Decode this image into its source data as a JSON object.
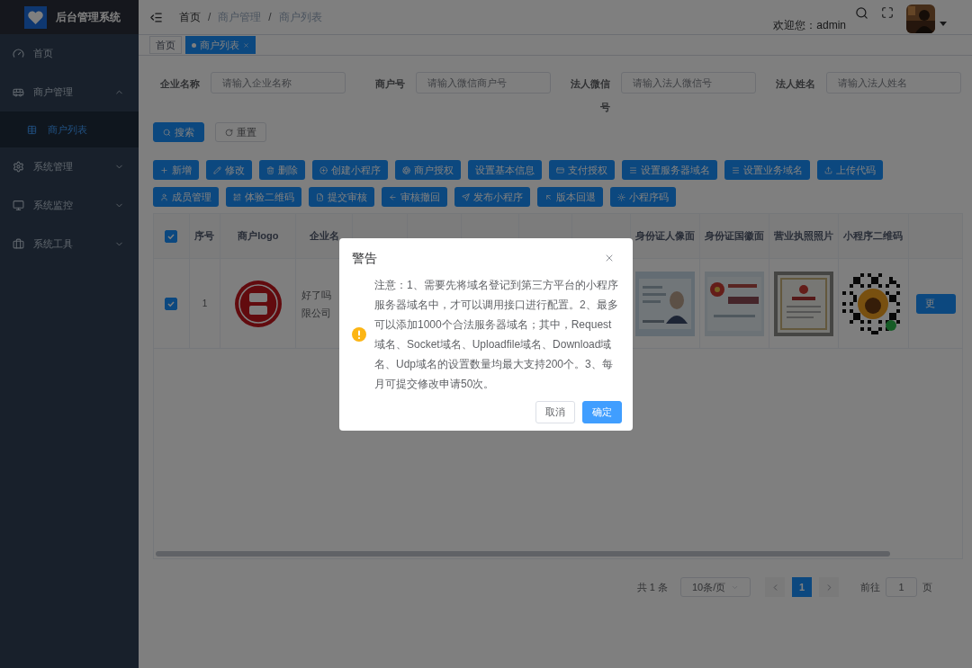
{
  "sidebar": {
    "title": "后台管理系统",
    "items": [
      {
        "label": "首页",
        "kind": "link"
      },
      {
        "label": "商户管理",
        "kind": "group",
        "expanded": true,
        "children": [
          {
            "label": "商户列表",
            "selected": true
          }
        ]
      },
      {
        "label": "系统管理",
        "kind": "group",
        "expanded": false
      },
      {
        "label": "系统监控",
        "kind": "group",
        "expanded": false
      },
      {
        "label": "系统工具",
        "kind": "group",
        "expanded": false
      }
    ]
  },
  "header": {
    "separator": "/",
    "breadcrumb": [
      {
        "label": "首页",
        "link": true
      },
      {
        "label": "商户管理",
        "link": false
      },
      {
        "label": "商户列表",
        "link": false
      }
    ],
    "welcome": "欢迎您：admin"
  },
  "tags": [
    {
      "label": "首页",
      "selected": false
    },
    {
      "label": "商户列表",
      "selected": true
    }
  ],
  "filters": [
    {
      "label": "企业名称",
      "placeholder": "请输入企业名称"
    },
    {
      "label": "商户号",
      "placeholder": "请输入微信商户号"
    },
    {
      "label": "法人微信号",
      "placeholder": "请输入法人微信号"
    },
    {
      "label": "法人姓名",
      "placeholder": "请输入法人姓名"
    }
  ],
  "search_buttons": [
    {
      "label": "搜索",
      "kind": "primary"
    },
    {
      "label": "重置",
      "kind": "default"
    }
  ],
  "toolbar_rows": [
    [
      "新增",
      "修改",
      "删除",
      "创建小程序",
      "商户授权",
      "设置基本信息",
      "支付授权",
      "设置服务器域名",
      "设置业务域名",
      "上传代码"
    ],
    [
      "成员管理",
      "体验二维码",
      "提交审核",
      "审核撤回",
      "发布小程序",
      "版本回退",
      "小程序码"
    ]
  ],
  "table": {
    "all_checked": true,
    "columns": [
      "序号",
      "商户logo",
      "企业名",
      "身份证人像面",
      "身份证国徽面",
      "营业执照照片",
      "小程序二维码"
    ],
    "rows": [
      {
        "checked": true,
        "index": "1",
        "company": [
          "好了吗",
          "限公司"
        ],
        "more": "更"
      }
    ]
  },
  "pagination": {
    "total": "共 1 条",
    "page_size": "10条/页",
    "pages": [
      {
        "label": "1",
        "selected": true
      }
    ],
    "goto_label": "前往",
    "goto_value": "1",
    "goto_suffix": "页"
  },
  "dialog": {
    "title": "警告",
    "message": "注意：1、需要先将域名登记到第三方平台的小程序服务器域名中，才可以调用接口进行配置。2、最多可以添加1000个合法服务器域名；其中，Request域名、Socket域名、Uploadfile域名、Download域名、Udp域名的设置数量均最大支持200个。3、每月可提交修改申请50次。",
    "buttons": [
      {
        "label": "取消",
        "kind": "default"
      },
      {
        "label": "确定",
        "kind": "primary"
      }
    ]
  }
}
